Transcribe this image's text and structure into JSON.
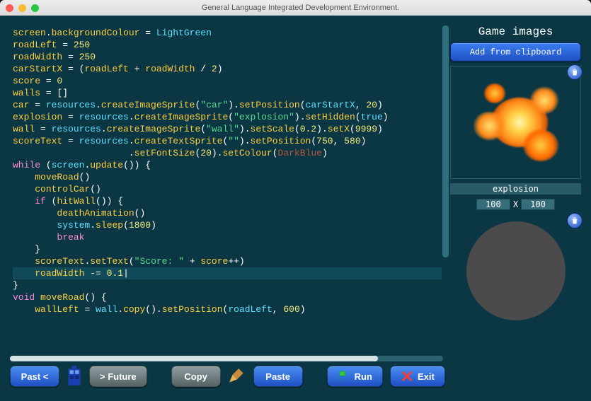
{
  "window": {
    "title": "General Language Integrated Development Environment."
  },
  "code": {
    "lines": [
      [
        [
          "t-var",
          "screen"
        ],
        [
          "t-pl",
          "."
        ],
        [
          "t-call",
          "backgroundColour"
        ],
        [
          "t-pl",
          " = "
        ],
        [
          "t-id",
          "LightGreen"
        ]
      ],
      [
        [
          "t-var",
          "roadLeft"
        ],
        [
          "t-pl",
          " = "
        ],
        [
          "t-num",
          "250"
        ]
      ],
      [
        [
          "t-var",
          "roadWidth"
        ],
        [
          "t-pl",
          " = "
        ],
        [
          "t-num",
          "250"
        ]
      ],
      [
        [
          "t-var",
          "carStartX"
        ],
        [
          "t-pl",
          " = ("
        ],
        [
          "t-var",
          "roadLeft"
        ],
        [
          "t-pl",
          " + "
        ],
        [
          "t-var",
          "roadWidth"
        ],
        [
          "t-pl",
          " / "
        ],
        [
          "t-num",
          "2"
        ],
        [
          "t-pl",
          ")"
        ]
      ],
      [
        [
          "t-var",
          "score"
        ],
        [
          "t-pl",
          " = "
        ],
        [
          "t-num",
          "0"
        ]
      ],
      [
        [
          "t-var",
          "walls"
        ],
        [
          "t-pl",
          " = []"
        ]
      ],
      [
        [
          "t-pl",
          ""
        ]
      ],
      [
        [
          "t-var",
          "car"
        ],
        [
          "t-pl",
          " = "
        ],
        [
          "t-id",
          "resources"
        ],
        [
          "t-pl",
          "."
        ],
        [
          "t-call",
          "createImageSprite"
        ],
        [
          "t-pl",
          "("
        ],
        [
          "t-str",
          "\"car\""
        ],
        [
          "t-pl",
          ")."
        ],
        [
          "t-call",
          "setPosition"
        ],
        [
          "t-pl",
          "("
        ],
        [
          "t-arg",
          "carStartX"
        ],
        [
          "t-pl",
          ", "
        ],
        [
          "t-num",
          "20"
        ],
        [
          "t-pl",
          ")"
        ]
      ],
      [
        [
          "t-var",
          "explosion"
        ],
        [
          "t-pl",
          " = "
        ],
        [
          "t-id",
          "resources"
        ],
        [
          "t-pl",
          "."
        ],
        [
          "t-call",
          "createImageSprite"
        ],
        [
          "t-pl",
          "("
        ],
        [
          "t-str",
          "\"explosion\""
        ],
        [
          "t-pl",
          ")."
        ],
        [
          "t-call",
          "setHidden"
        ],
        [
          "t-pl",
          "("
        ],
        [
          "t-arg",
          "true"
        ],
        [
          "t-pl",
          ")"
        ]
      ],
      [
        [
          "t-var",
          "wall"
        ],
        [
          "t-pl",
          " = "
        ],
        [
          "t-id",
          "resources"
        ],
        [
          "t-pl",
          "."
        ],
        [
          "t-call",
          "createImageSprite"
        ],
        [
          "t-pl",
          "("
        ],
        [
          "t-str",
          "\"wall\""
        ],
        [
          "t-pl",
          ")."
        ],
        [
          "t-call",
          "setScale"
        ],
        [
          "t-pl",
          "("
        ],
        [
          "t-num",
          "0.2"
        ],
        [
          "t-pl",
          ")."
        ],
        [
          "t-call",
          "setX"
        ],
        [
          "t-pl",
          "("
        ],
        [
          "t-num",
          "9999"
        ],
        [
          "t-pl",
          ")"
        ]
      ],
      [
        [
          "t-var",
          "scoreText"
        ],
        [
          "t-pl",
          " = "
        ],
        [
          "t-id",
          "resources"
        ],
        [
          "t-pl",
          "."
        ],
        [
          "t-call",
          "createTextSprite"
        ],
        [
          "t-pl",
          "("
        ],
        [
          "t-str",
          "\"\""
        ],
        [
          "t-pl",
          ")."
        ],
        [
          "t-call",
          "setPosition"
        ],
        [
          "t-pl",
          "("
        ],
        [
          "t-num",
          "750"
        ],
        [
          "t-pl",
          ", "
        ],
        [
          "t-num",
          "580"
        ],
        [
          "t-pl",
          ")"
        ]
      ],
      [
        [
          "t-pl",
          "                     ."
        ],
        [
          "t-call",
          "setFontSize"
        ],
        [
          "t-pl",
          "("
        ],
        [
          "t-num",
          "20"
        ],
        [
          "t-pl",
          ")."
        ],
        [
          "t-call",
          "setColour"
        ],
        [
          "t-pl",
          "("
        ],
        [
          "t-dkred",
          "DarkBlue"
        ],
        [
          "t-pl",
          ")"
        ]
      ],
      [
        [
          "t-pl",
          ""
        ]
      ],
      [
        [
          "t-k",
          "while"
        ],
        [
          "t-pl",
          " ("
        ],
        [
          "t-id",
          "screen"
        ],
        [
          "t-pl",
          "."
        ],
        [
          "t-call",
          "update"
        ],
        [
          "t-pl",
          "()) {"
        ]
      ],
      [
        [
          "t-pl",
          "    "
        ],
        [
          "t-call",
          "moveRoad"
        ],
        [
          "t-pl",
          "()"
        ]
      ],
      [
        [
          "t-pl",
          "    "
        ],
        [
          "t-call",
          "controlCar"
        ],
        [
          "t-pl",
          "()"
        ]
      ],
      [
        [
          "t-pl",
          "    "
        ],
        [
          "t-k",
          "if"
        ],
        [
          "t-pl",
          " ("
        ],
        [
          "t-call",
          "hitWall"
        ],
        [
          "t-pl",
          "()) {"
        ]
      ],
      [
        [
          "t-pl",
          "        "
        ],
        [
          "t-call",
          "deathAnimation"
        ],
        [
          "t-pl",
          "()"
        ]
      ],
      [
        [
          "t-pl",
          "        "
        ],
        [
          "t-id",
          "system"
        ],
        [
          "t-pl",
          "."
        ],
        [
          "t-call",
          "sleep"
        ],
        [
          "t-pl",
          "("
        ],
        [
          "t-num",
          "1800"
        ],
        [
          "t-pl",
          ")"
        ]
      ],
      [
        [
          "t-pl",
          "        "
        ],
        [
          "t-k",
          "break"
        ]
      ],
      [
        [
          "t-pl",
          "    }"
        ]
      ],
      [
        [
          "t-pl",
          "    "
        ],
        [
          "t-var",
          "scoreText"
        ],
        [
          "t-pl",
          "."
        ],
        [
          "t-call",
          "setText"
        ],
        [
          "t-pl",
          "("
        ],
        [
          "t-str",
          "\"Score: \""
        ],
        [
          "t-pl",
          " + "
        ],
        [
          "t-var",
          "score"
        ],
        [
          "t-pl",
          "++)"
        ]
      ],
      [
        [
          "t-pl",
          "    "
        ],
        [
          "t-var",
          "roadWidth"
        ],
        [
          "t-pl",
          " -= "
        ],
        [
          "t-num",
          "0.1"
        ],
        [
          "t-pl",
          "|"
        ]
      ],
      [
        [
          "t-pl",
          "}"
        ]
      ],
      [
        [
          "t-pl",
          ""
        ]
      ],
      [
        [
          "t-k",
          "void"
        ],
        [
          "t-pl",
          " "
        ],
        [
          "t-call",
          "moveRoad"
        ],
        [
          "t-pl",
          "() {"
        ]
      ],
      [
        [
          "t-pl",
          "    "
        ],
        [
          "t-var",
          "wallLeft"
        ],
        [
          "t-pl",
          " = "
        ],
        [
          "t-id",
          "wall"
        ],
        [
          "t-pl",
          "."
        ],
        [
          "t-call",
          "copy"
        ],
        [
          "t-pl",
          "()."
        ],
        [
          "t-call",
          "setPosition"
        ],
        [
          "t-pl",
          "("
        ],
        [
          "t-arg",
          "roadLeft"
        ],
        [
          "t-pl",
          ", "
        ],
        [
          "t-num",
          "600"
        ],
        [
          "t-pl",
          ")"
        ]
      ]
    ],
    "highlight_line": 22
  },
  "side": {
    "title": "Game images",
    "add_btn": "Add from clipboard",
    "sprite_name": "explosion",
    "dim_w": "100",
    "dim_h": "100",
    "dim_sep": "X"
  },
  "toolbar": {
    "past": "Past <",
    "future": "> Future",
    "copy": "Copy",
    "paste": "Paste",
    "run": "Run",
    "exit": "Exit"
  },
  "icons": {
    "trash": "trash-icon",
    "flag": "flag-icon",
    "close": "close-icon",
    "broom": "broom-icon"
  }
}
